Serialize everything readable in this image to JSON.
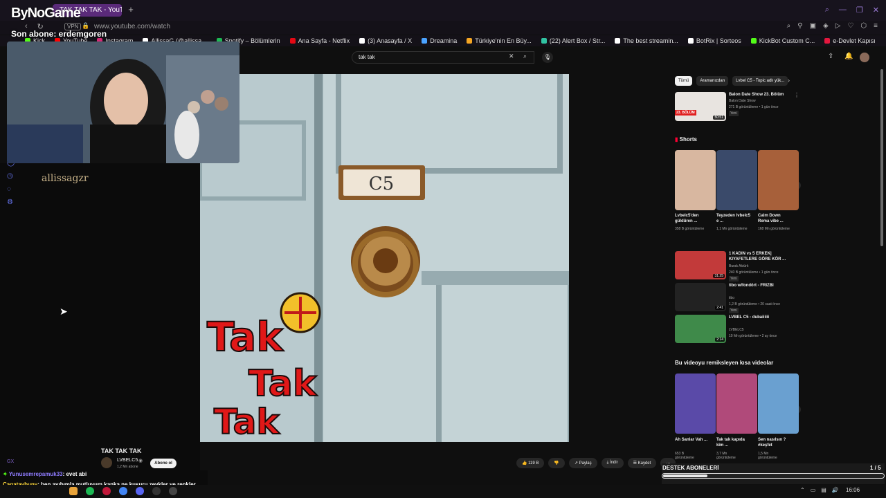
{
  "browser": {
    "tab_title": "TAK TAK TAK - YouTube",
    "new_tab": "+",
    "vpn_badge": "VPN",
    "url": "www.youtube.com/watch"
  },
  "bookmarks": [
    {
      "label": "Kick",
      "color": "#53fc18"
    },
    {
      "label": "YouTube",
      "color": "#ff0000"
    },
    {
      "label": "Instagram",
      "color": "#d62976"
    },
    {
      "label": "AllissaG (@allissa...",
      "color": "#ffffff"
    },
    {
      "label": "Spotify – Bölümlerin",
      "color": "#1db954"
    },
    {
      "label": "Ana Sayfa - Netflix",
      "color": "#e50914"
    },
    {
      "label": "(3) Anasayfa / X",
      "color": "#ffffff"
    },
    {
      "label": "Dreamina",
      "color": "#4aa3ff"
    },
    {
      "label": "Türkiye'nin En Büy...",
      "color": "#f5a623"
    },
    {
      "label": "(22) Alert Box / Str...",
      "color": "#31c3a2"
    },
    {
      "label": "The best streamin...",
      "color": "#ffffff"
    },
    {
      "label": "BotRix | Sorteos",
      "color": "#ffffff"
    },
    {
      "label": "KickBot Custom C...",
      "color": "#53fc18"
    },
    {
      "label": "e-Devlet Kapısı",
      "color": "#e4173e"
    }
  ],
  "overlay": {
    "logo": "ByNoGame",
    "subscriber_line": "Son abone: erdemgoren",
    "watermark": "allissagzr"
  },
  "search": {
    "query": "tak tak"
  },
  "video": {
    "title": "TAK TAK TAK",
    "channel": "LVBELC5",
    "subscribers": "1,2 Mn abone",
    "subscribe_label": "Abone ol",
    "likes": "119 B",
    "share_label": "Paylaş",
    "download_label": "İndir",
    "save_label": "Kaydet",
    "door_number": "C5",
    "art_words": [
      "Tak",
      "Tak",
      "Tak"
    ]
  },
  "chips": [
    "Tümü",
    "Aramanızdan",
    "Lvbel C5 - Topic adlı yük..."
  ],
  "related_top": {
    "title": "Balon Date Show 23. Bölüm",
    "channel": "Balon Date Show",
    "meta": "271 B görüntüleme • 1 gün önce",
    "badge": "Yeni",
    "duration": "50:51",
    "thumb_badge": "23. BÖLÜM"
  },
  "shorts_header": "Shorts",
  "shorts": [
    {
      "title": "Lvbelc5'den güldüren ...",
      "views": "358 B görüntüleme",
      "color": "#d8b7a0"
    },
    {
      "title": "Teyzeden lvbelc5 e ...",
      "views": "1,1 Mn görüntüleme",
      "color": "#3a4a6a"
    },
    {
      "title": "Calm Down Rema vibe ...",
      "views": "168 Mn görüntüleme",
      "color": "#a7603a"
    }
  ],
  "related": [
    {
      "title": "1 KADIN vs 5 ERKEK| KIYAFETLERE GÖRE KÖR ...",
      "channel": "Burak Aktürk",
      "meta": "240 B görüntüleme • 1 gün önce",
      "badge": "Yeni",
      "duration": "31:25",
      "color": "#c23a3a"
    },
    {
      "title": "tibo w/fondört - FRIZBI",
      "channel": "tibo",
      "meta": "1,2 B görüntüleme • 20 saat önce",
      "badge": "Yeni",
      "duration": "2:41",
      "color": "#222222"
    },
    {
      "title": "LVBEL C5 - dubaiiiiii",
      "channel": "LVBELC5",
      "meta": "10 Mn görüntüleme • 2 ay önce",
      "badge": "",
      "duration": "2:14",
      "color": "#3f8a4a"
    }
  ],
  "remix_header": "Bu videoyu remiksleyen kısa videolar",
  "remixes": [
    {
      "title": "Ah Sanlar Vah ...",
      "views": "653 B",
      "color": "#5a4aa8"
    },
    {
      "title": "Tak tak kapıda kim ...",
      "views": "3,7 Mn",
      "color": "#b04a7a"
    },
    {
      "title": "Sen nasılsın ? #keşfet",
      "views": "1,5 Mn",
      "color": "#6aa0d0"
    }
  ],
  "remix_views_suffix": "görüntüleme",
  "chat": [
    {
      "user": "Yunusemrepamuk33",
      "text": ": evet abi"
    },
    {
      "user": "Cagataybuny",
      "text": ": ben ayıbımla mutluyum kanka ne kusuru zevkler ve renkler tartışılmaz ama bana göre değil"
    }
  ],
  "support": {
    "label": "DESTEK ABONELERİ",
    "count": "1 / 5",
    "progress": 0.2
  },
  "gx_label": "GX",
  "taskbar": {
    "time": "16:06"
  },
  "colors": {
    "brand_purple": "#5a2a7a",
    "yt_bg": "#0f0f0f",
    "chat_user": "#8f7cff"
  }
}
